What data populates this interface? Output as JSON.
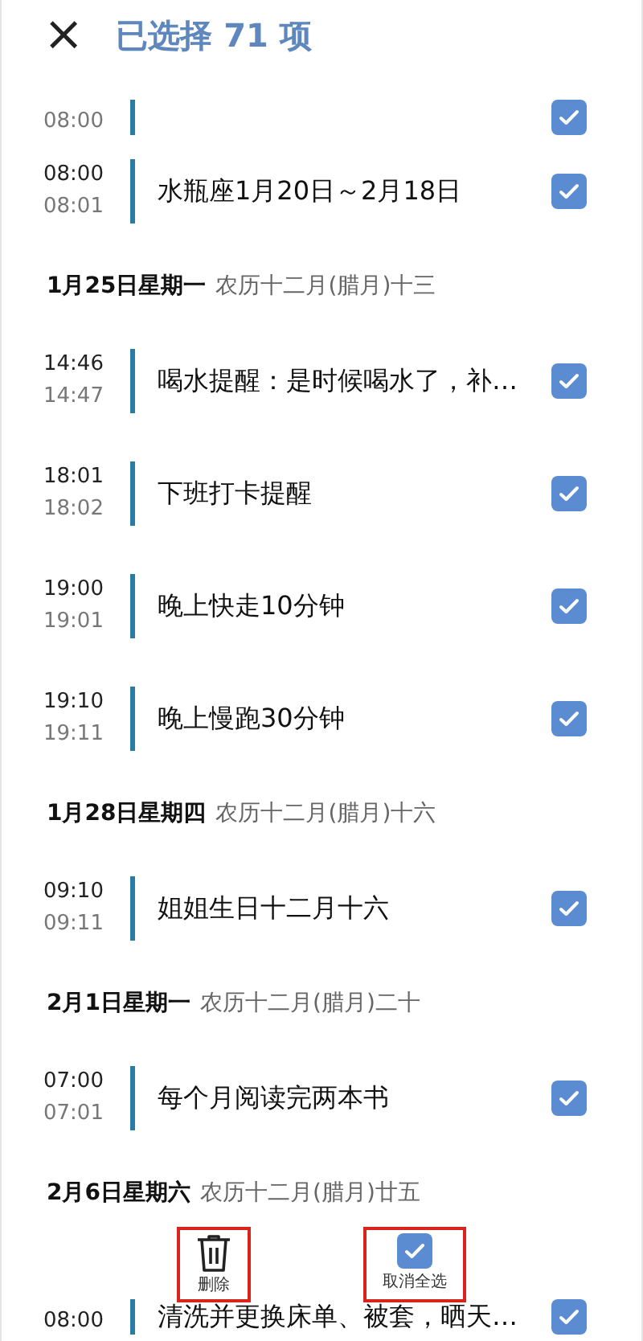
{
  "header": {
    "close": "×",
    "title": "已选择 71 项"
  },
  "list": [
    {
      "kind": "event",
      "end": "08:00",
      "checked": true
    },
    {
      "kind": "event",
      "start": "08:00",
      "end": "08:01",
      "title": "水瓶座1月20日～2月18日",
      "checked": true
    },
    {
      "kind": "date",
      "date": "1月25日星期一",
      "lunar": "农历十二月(腊月)十三"
    },
    {
      "kind": "event",
      "start": "14:46",
      "end": "14:47",
      "title": "喝水提醒：是时候喝水了，补…",
      "checked": true
    },
    {
      "kind": "event",
      "start": "18:01",
      "end": "18:02",
      "title": "下班打卡提醒",
      "checked": true
    },
    {
      "kind": "event",
      "start": "19:00",
      "end": "19:01",
      "title": "晚上快走10分钟",
      "checked": true
    },
    {
      "kind": "event",
      "start": "19:10",
      "end": "19:11",
      "title": "晚上慢跑30分钟",
      "checked": true
    },
    {
      "kind": "date",
      "date": "1月28日星期四",
      "lunar": "农历十二月(腊月)十六"
    },
    {
      "kind": "event",
      "start": "09:10",
      "end": "09:11",
      "title": "姐姐生日十二月十六",
      "checked": true
    },
    {
      "kind": "date",
      "date": "2月1日星期一",
      "lunar": "农历十二月(腊月)二十"
    },
    {
      "kind": "event",
      "start": "07:00",
      "end": "07:01",
      "title": "每个月阅读完两本书",
      "checked": true
    },
    {
      "kind": "date",
      "date": "2月6日星期六",
      "lunar": "农历十二月(腊月)廿五"
    },
    {
      "kind": "event",
      "start": "08:00",
      "title": "清洗并更换床单、被套，晒天…",
      "checked": true
    }
  ],
  "actions": [
    {
      "kind": "delete",
      "label": "删除",
      "highlighted": true
    },
    {
      "kind": "select_all",
      "label": "取消全选",
      "checked": true,
      "highlighted": true
    }
  ]
}
